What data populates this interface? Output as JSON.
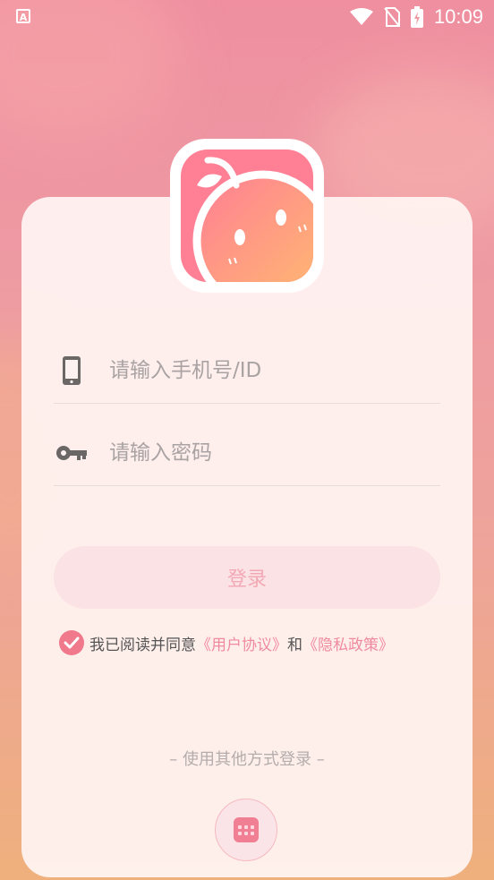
{
  "status_bar": {
    "time": "10:09",
    "app_icon_letter": "A",
    "icons": [
      "wifi-icon",
      "no-sim-icon",
      "battery-charging-icon"
    ]
  },
  "logo": {
    "icon": "peach-logo-icon"
  },
  "form": {
    "phone": {
      "icon": "phone-icon",
      "placeholder": "请输入手机号/ID",
      "value": ""
    },
    "password": {
      "icon": "key-icon",
      "placeholder": "请输入密码",
      "value": ""
    },
    "login_label": "登录"
  },
  "agreement": {
    "checked": true,
    "prefix": "我已阅读并同意",
    "user_agreement": "《用户协议》",
    "and": "和",
    "privacy_policy": "《隐私政策》"
  },
  "other_login": {
    "label": "– 使用其他方式登录 –",
    "button_icon": "keypad-icon"
  },
  "colors": {
    "accent": "#f0798b",
    "link": "#f08aa0",
    "login_button_bg": "#fbe2e4",
    "login_button_text": "#f3a9b5"
  }
}
